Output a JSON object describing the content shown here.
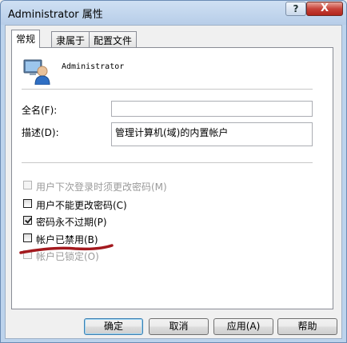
{
  "window": {
    "title": "Administrator 属性",
    "help_label": "?",
    "close_label": "X"
  },
  "tabs": [
    {
      "label": "常规",
      "active": true
    },
    {
      "label": "隶属于",
      "active": false
    },
    {
      "label": "配置文件",
      "active": false
    }
  ],
  "general": {
    "account_name": "Administrator",
    "full_name_label": "全名(F):",
    "full_name_value": "",
    "description_label": "描述(D):",
    "description_value": "管理计算机(域)的内置帐户",
    "checkboxes": [
      {
        "label": "用户下次登录时须更改密码(M)",
        "checked": false,
        "enabled": false
      },
      {
        "label": "用户不能更改密码(C)",
        "checked": false,
        "enabled": true
      },
      {
        "label": "密码永不过期(P)",
        "checked": true,
        "enabled": true
      },
      {
        "label": "帐户已禁用(B)",
        "checked": false,
        "enabled": true
      },
      {
        "label": "帐户已锁定(O)",
        "checked": false,
        "enabled": false
      }
    ]
  },
  "buttons": {
    "ok": "确定",
    "cancel": "取消",
    "apply": "应用(A)",
    "help": "帮助"
  },
  "colors": {
    "annotation_mark": "#a3191e",
    "title_bar": "#bcd3ec",
    "close_button": "#c7433a"
  },
  "icons": {
    "account": "user-account-icon"
  }
}
